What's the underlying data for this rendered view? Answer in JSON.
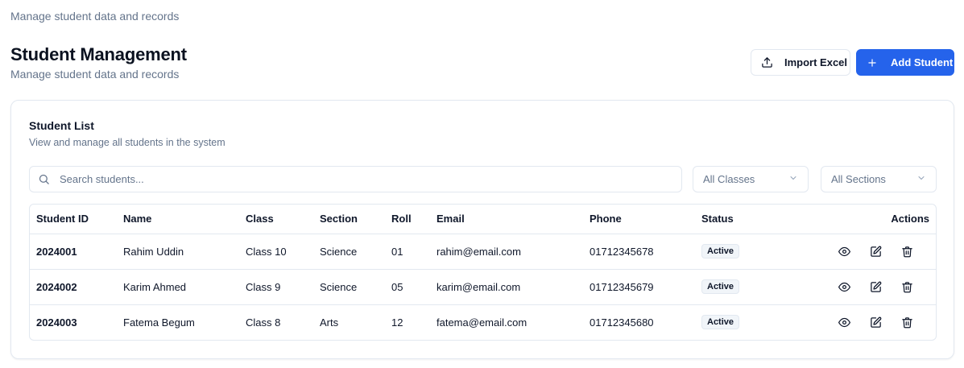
{
  "page": {
    "top_subtitle": "Manage student data and records",
    "title": "Student Management",
    "subtitle": "Manage student data and records"
  },
  "buttons": {
    "import_label": "Import Excel",
    "add_label": "Add Student",
    "import_icon": "upload-icon",
    "add_icon": "plus-icon"
  },
  "card": {
    "title": "Student List",
    "description": "View and manage all students in the system"
  },
  "filters": {
    "search_placeholder": "Search students...",
    "class_selected": "All Classes",
    "section_selected": "All Sections"
  },
  "table": {
    "headers": {
      "student_id": "Student ID",
      "name": "Name",
      "class": "Class",
      "section": "Section",
      "roll": "Roll",
      "email": "Email",
      "phone": "Phone",
      "status": "Status",
      "actions": "Actions"
    },
    "rows": [
      {
        "id": "2024001",
        "name": "Rahim Uddin",
        "class": "Class 10",
        "section": "Science",
        "roll": "01",
        "email": "rahim@email.com",
        "phone": "01712345678",
        "status": "Active"
      },
      {
        "id": "2024002",
        "name": "Karim Ahmed",
        "class": "Class 9",
        "section": "Science",
        "roll": "05",
        "email": "karim@email.com",
        "phone": "01712345679",
        "status": "Active"
      },
      {
        "id": "2024003",
        "name": "Fatema Begum",
        "class": "Class 8",
        "section": "Arts",
        "roll": "12",
        "email": "fatema@email.com",
        "phone": "01712345680",
        "status": "Active"
      }
    ]
  },
  "colors": {
    "primary": "#2563eb",
    "border": "#e2e8f0",
    "muted_text": "#64748b",
    "badge_bg": "#f1f5f9"
  }
}
